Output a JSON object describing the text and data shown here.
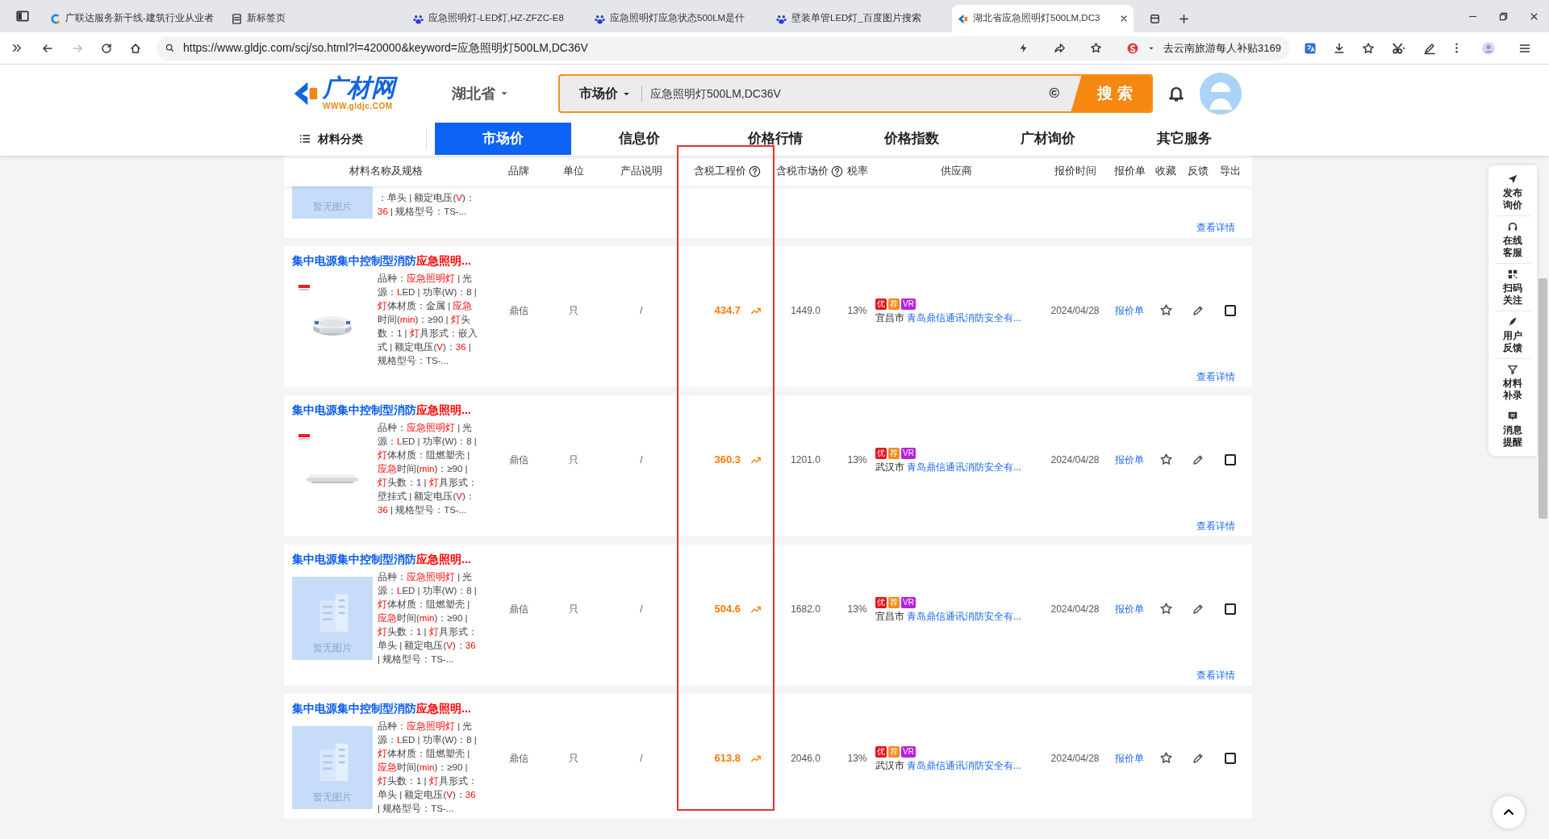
{
  "browser": {
    "tabs": [
      {
        "title": "广联达服务新干线-建筑行业从业者",
        "selected": false
      },
      {
        "title": "新标签页",
        "selected": false
      },
      {
        "title": "应急照明灯-LED灯,HZ-ZFZC-E8",
        "selected": false
      },
      {
        "title": "应急照明灯应急状态500LM是什",
        "selected": false
      },
      {
        "title": "壁装单管LED灯_百度图片搜索",
        "selected": false
      },
      {
        "title": "湖北省应急照明灯500LM,DC3",
        "selected": true
      }
    ],
    "url": "https://www.gldjc.com/scj/so.html?l=420000&keyword=应急照明灯500LM,DC36V",
    "promo": "去云南旅游每人补贴3169"
  },
  "header": {
    "logo": "广材网",
    "logo_url": "WWW.gldjc.COM",
    "region": "湖北省",
    "search": {
      "scope": "市场价",
      "value": "应急照明灯500LM,DC36V",
      "clear": "©",
      "button": "搜 索"
    }
  },
  "nav": {
    "categories": "材料分类",
    "tabs": [
      {
        "label": "市场价",
        "selected": true
      },
      {
        "label": "信息价",
        "selected": false
      },
      {
        "label": "价格行情",
        "selected": false
      },
      {
        "label": "价格指数",
        "selected": false
      },
      {
        "label": "广材询价",
        "selected": false
      },
      {
        "label": "其它服务",
        "selected": false
      }
    ]
  },
  "table": {
    "columns": [
      {
        "label": "材料名称及规格",
        "help": false
      },
      {
        "label": "品牌",
        "help": false
      },
      {
        "label": "单位",
        "help": false
      },
      {
        "label": "产品说明",
        "help": false
      },
      {
        "label": "含税工程价",
        "help": true
      },
      {
        "label": "含税市场价",
        "help": true
      },
      {
        "label": "税率",
        "help": false
      },
      {
        "label": "供应商",
        "help": false
      },
      {
        "label": "报价时间",
        "help": false
      },
      {
        "label": "报价单",
        "help": false
      },
      {
        "label": "收藏",
        "help": false
      },
      {
        "label": "反馈",
        "help": false
      },
      {
        "label": "导出",
        "help": false
      }
    ],
    "partial_row": {
      "image": {
        "kind": "placeholder",
        "label": "暂无图片"
      },
      "spec": [
        {
          "text": "：单头 | 额定电压("
        },
        {
          "text": "V",
          "highlight": true
        },
        {
          "text": ")："
        },
        {
          "text": "36",
          "highlight": true
        },
        {
          "text": " | 规格型号：TS-..."
        }
      ],
      "details": "查看详情"
    },
    "rows": [
      {
        "title": [
          {
            "text": "集中电源集中控制型消防"
          },
          {
            "text": "应急照明...",
            "highlight": true
          }
        ],
        "image": {
          "kind": "picture"
        },
        "spec": [
          {
            "text": "品种："
          },
          {
            "text": "应急照明灯",
            "highlight": true
          },
          {
            "text": " | 光源："
          },
          {
            "text": "L",
            "highlight": true
          },
          {
            "text": "ED | 功率(W)：8 | "
          },
          {
            "text": "灯",
            "highlight": true
          },
          {
            "text": "体材质：金属 | "
          },
          {
            "text": "应急",
            "highlight": true
          },
          {
            "text": "时间("
          },
          {
            "text": "min",
            "highlight": true
          },
          {
            "text": ")：≥90 | "
          },
          {
            "text": "灯",
            "highlight": true
          },
          {
            "text": "头数：1 | "
          },
          {
            "text": "灯",
            "highlight": true
          },
          {
            "text": "具形式：嵌入式 | 额定电压("
          },
          {
            "text": "V",
            "highlight": true
          },
          {
            "text": ")："
          },
          {
            "text": "36",
            "highlight": true
          },
          {
            "text": " | 规格型号：TS-..."
          }
        ],
        "brand": "鼎信",
        "unit": "只",
        "description": "/",
        "engineering_price": "434.7",
        "market_price": "1449.0",
        "tax_rate": "13%",
        "badges": [
          {
            "label": "优",
            "color": "#e8131b"
          },
          {
            "label": "荐",
            "color": "#f28a18"
          },
          {
            "label": "VR",
            "color": "#b620e0"
          }
        ],
        "city": "宜昌市",
        "supplier": "青岛鼎信通讯消防安全有...",
        "date": "2024/04/28",
        "quote": "报价单",
        "favorited": false,
        "selected": false,
        "details": "查看详情"
      },
      {
        "title": [
          {
            "text": "集中电源集中控制型消防"
          },
          {
            "text": "应急照明...",
            "highlight": true
          }
        ],
        "image": {
          "kind": "picture"
        },
        "spec": [
          {
            "text": "品种："
          },
          {
            "text": "应急照明灯",
            "highlight": true
          },
          {
            "text": " | 光源："
          },
          {
            "text": "L",
            "highlight": true
          },
          {
            "text": "ED | 功率(W)：8 | "
          },
          {
            "text": "灯",
            "highlight": true
          },
          {
            "text": "体材质：阻燃塑壳 | "
          },
          {
            "text": "应急",
            "highlight": true
          },
          {
            "text": "时间("
          },
          {
            "text": "min",
            "highlight": true
          },
          {
            "text": ")：≥90 | "
          },
          {
            "text": "灯",
            "highlight": true
          },
          {
            "text": "头数：1 | "
          },
          {
            "text": "灯",
            "highlight": true
          },
          {
            "text": "具形式：壁挂式 | 额定电压("
          },
          {
            "text": "V",
            "highlight": true
          },
          {
            "text": ")："
          },
          {
            "text": "36",
            "highlight": true
          },
          {
            "text": " | 规格型号：TS-..."
          }
        ],
        "brand": "鼎信",
        "unit": "只",
        "description": "/",
        "engineering_price": "360.3",
        "market_price": "1201.0",
        "tax_rate": "13%",
        "badges": [
          {
            "label": "优",
            "color": "#e8131b"
          },
          {
            "label": "荐",
            "color": "#f28a18"
          },
          {
            "label": "VR",
            "color": "#b620e0"
          }
        ],
        "city": "武汉市",
        "supplier": "青岛鼎信通讯消防安全有...",
        "date": "2024/04/28",
        "quote": "报价单",
        "favorited": false,
        "selected": false,
        "details": "查看详情"
      },
      {
        "title": [
          {
            "text": "集中电源集中控制型消防"
          },
          {
            "text": "应急照明...",
            "highlight": true
          }
        ],
        "image": {
          "kind": "placeholder",
          "label": "暂无图片"
        },
        "spec": [
          {
            "text": "品种："
          },
          {
            "text": "应急照明灯",
            "highlight": true
          },
          {
            "text": " | 光源："
          },
          {
            "text": "L",
            "highlight": true
          },
          {
            "text": "ED | 功率(W)：8 | "
          },
          {
            "text": "灯",
            "highlight": true
          },
          {
            "text": "体材质：阻燃塑壳 | "
          },
          {
            "text": "应急",
            "highlight": true
          },
          {
            "text": "时间("
          },
          {
            "text": "min",
            "highlight": true
          },
          {
            "text": ")：≥90 | "
          },
          {
            "text": "灯",
            "highlight": true
          },
          {
            "text": "头数：1 | "
          },
          {
            "text": "灯",
            "highlight": true
          },
          {
            "text": "具形式：单头 | 额定电压("
          },
          {
            "text": "V",
            "highlight": true
          },
          {
            "text": ")："
          },
          {
            "text": "36",
            "highlight": true
          },
          {
            "text": " | 规格型号：TS-..."
          }
        ],
        "brand": "鼎信",
        "unit": "只",
        "description": "/",
        "engineering_price": "504.6",
        "market_price": "1682.0",
        "tax_rate": "13%",
        "badges": [
          {
            "label": "优",
            "color": "#e8131b"
          },
          {
            "label": "荐",
            "color": "#f28a18"
          },
          {
            "label": "VR",
            "color": "#b620e0"
          }
        ],
        "city": "宜昌市",
        "supplier": "青岛鼎信通讯消防安全有...",
        "date": "2024/04/28",
        "quote": "报价单",
        "favorited": false,
        "selected": false,
        "details": "查看详情"
      },
      {
        "title": [
          {
            "text": "集中电源集中控制型消防"
          },
          {
            "text": "应急照明...",
            "highlight": true
          }
        ],
        "image": {
          "kind": "placeholder",
          "label": "暂无图片"
        },
        "spec": [
          {
            "text": "品种："
          },
          {
            "text": "应急照明灯",
            "highlight": true
          },
          {
            "text": " | 光源："
          },
          {
            "text": "L",
            "highlight": true
          },
          {
            "text": "ED | 功率(W)：8 | "
          },
          {
            "text": "灯",
            "highlight": true
          },
          {
            "text": "体材质：阻燃塑壳 | "
          },
          {
            "text": "应急",
            "highlight": true
          },
          {
            "text": "时间("
          },
          {
            "text": "min",
            "highlight": true
          },
          {
            "text": ")：≥90 | "
          },
          {
            "text": "灯",
            "highlight": true
          },
          {
            "text": "头数：1 | "
          },
          {
            "text": "灯",
            "highlight": true
          },
          {
            "text": "具形式：单头 | 额定电压("
          },
          {
            "text": "V",
            "highlight": true
          },
          {
            "text": ")："
          },
          {
            "text": "36",
            "highlight": true
          },
          {
            "text": " | 规格型号：TS-..."
          }
        ],
        "brand": "鼎信",
        "unit": "只",
        "description": "/",
        "engineering_price": "613.8",
        "market_price": "2046.0",
        "tax_rate": "13%",
        "badges": [
          {
            "label": "优",
            "color": "#e8131b"
          },
          {
            "label": "荐",
            "color": "#f28a18"
          },
          {
            "label": "VR",
            "color": "#b620e0"
          }
        ],
        "city": "武汉市",
        "supplier": "青岛鼎信通讯消防安全有...",
        "date": "2024/04/28",
        "quote": "报价单",
        "favorited": false,
        "selected": false
      }
    ]
  },
  "sidebar": [
    {
      "label": "发布询价"
    },
    {
      "label": "在线客服"
    },
    {
      "label": "扫码关注"
    },
    {
      "label": "用户反馈"
    },
    {
      "label": "材料补录"
    },
    {
      "label": "消息提醒"
    }
  ],
  "annotation": {
    "kind": "highlight-box"
  }
}
